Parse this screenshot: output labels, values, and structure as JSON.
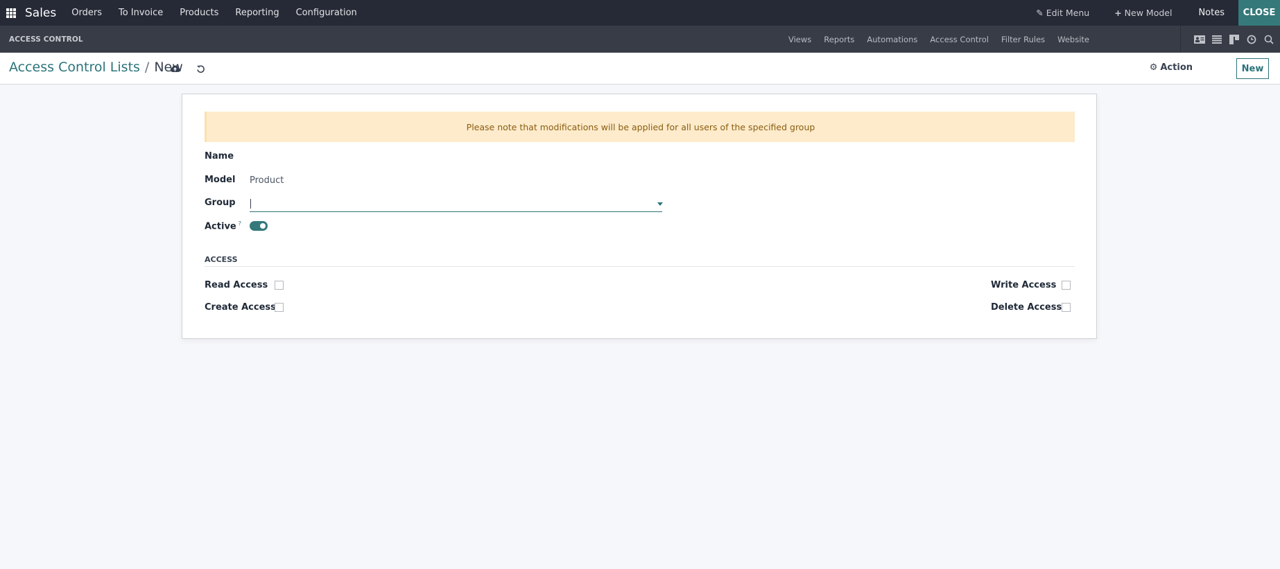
{
  "topbar": {
    "brand": "Sales",
    "menu": [
      "Orders",
      "To Invoice",
      "Products",
      "Reporting",
      "Configuration"
    ],
    "edit_menu": "Edit Menu",
    "new_model": "New Model",
    "notes": "Notes",
    "close": "CLOSE"
  },
  "studio": {
    "title": "ACCESS CONTROL",
    "menu": [
      "Views",
      "Reports",
      "Automations",
      "Access Control",
      "Filter Rules",
      "Website"
    ],
    "view_icons": [
      "form-view-icon",
      "list-view-icon",
      "kanban-view-icon",
      "activity-view-icon",
      "search-view-icon"
    ]
  },
  "control_panel": {
    "breadcrumb_parent": "Access Control Lists",
    "breadcrumb_sep": "/",
    "breadcrumb_current": "New",
    "action_label": "Action",
    "new_label": "New"
  },
  "form": {
    "alert": "Please note that modifications will be applied for all users of the specified group",
    "name_label": "Name",
    "model_label": "Model",
    "model_value": "Product",
    "group_label": "Group",
    "group_value": "",
    "active_label": "Active",
    "active_help": "?",
    "active_value": true,
    "section_title": "ACCESS",
    "access": {
      "read_label": "Read Access",
      "read_value": false,
      "create_label": "Create Access",
      "create_value": false,
      "write_label": "Write Access",
      "write_value": false,
      "delete_label": "Delete Access",
      "delete_value": false
    }
  },
  "colors": {
    "brand_teal": "#2a7479",
    "topbar_bg": "#262a36",
    "studio_bg": "#383c46",
    "alert_bg": "#fdebcc",
    "alert_text": "#8a5d0f"
  }
}
